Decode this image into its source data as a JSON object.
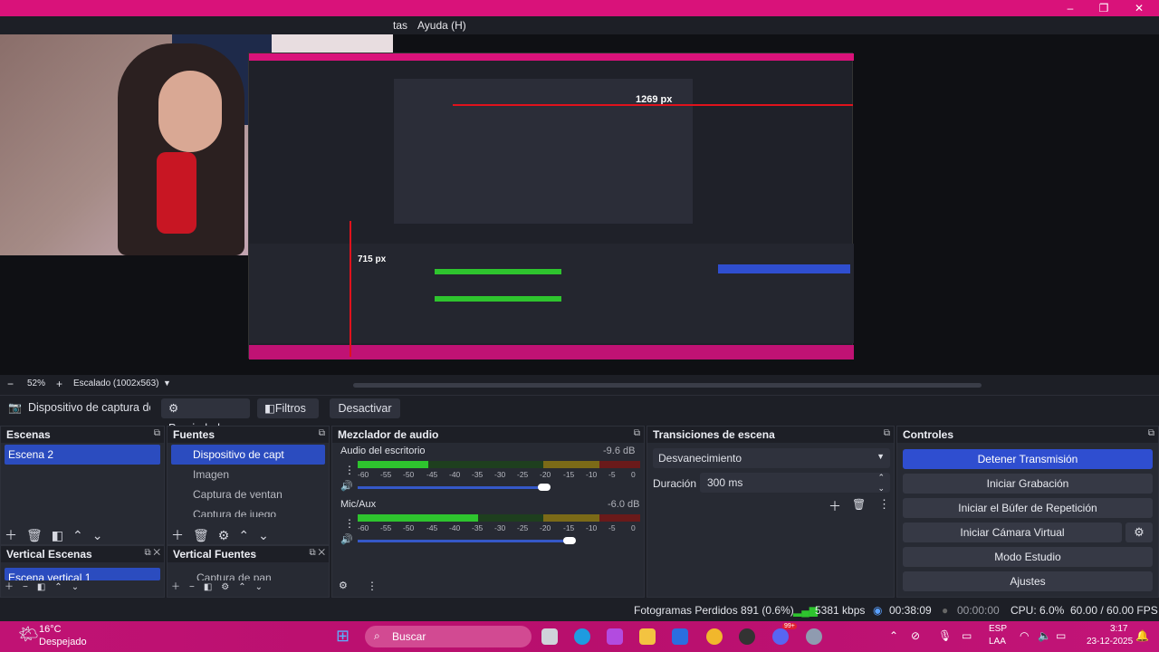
{
  "window": {
    "menu_partial": "tas",
    "menu_help": "Ayuda (H)",
    "minimize": "–",
    "maximize": "❐",
    "close": "✕"
  },
  "nested_preview": {
    "width_label": "1269 px",
    "height_label": "715 px"
  },
  "preview_toolbar": {
    "zoom": "52%",
    "scale_label": "Escalado (1002x563)"
  },
  "source_bar": {
    "source_name": "Dispositivo de captura de v",
    "properties": "Propiedades",
    "filters": "Filtros",
    "deactivate": "Desactivar"
  },
  "scenes": {
    "title": "Escenas",
    "items": [
      "Escena 2"
    ]
  },
  "sources": {
    "title": "Fuentes",
    "items": [
      "Dispositivo de capt",
      "Imagen",
      "Captura de ventan",
      "Captura de juego"
    ]
  },
  "vertical_scenes": {
    "title": "Vertical Escenas",
    "items": [
      "Escena vertical 1"
    ]
  },
  "vertical_sources": {
    "title": "Vertical Fuentes",
    "items": [
      "Captura de pan"
    ]
  },
  "mixer": {
    "title": "Mezclador de audio",
    "channels": [
      {
        "name": "Audio del escritorio",
        "db": "-9.6 dB",
        "level": 0.38,
        "volume": 0.66
      },
      {
        "name": "Mic/Aux",
        "db": "-6.0 dB",
        "level": 0.65,
        "volume": 0.75
      }
    ],
    "scale": [
      "-60",
      "-55",
      "-50",
      "-45",
      "-40",
      "-35",
      "-30",
      "-25",
      "-20",
      "-15",
      "-10",
      "-5",
      "0"
    ]
  },
  "transitions": {
    "title": "Transiciones de escena",
    "selected": "Desvanecimiento",
    "duration_label": "Duración",
    "duration_value": "300 ms"
  },
  "controls": {
    "title": "Controles",
    "buttons": [
      "Detener Transmisión",
      "Iniciar Grabación",
      "Iniciar el Búfer de Repetición",
      "Iniciar Cámara Virtual",
      "Modo Estudio",
      "Ajustes"
    ]
  },
  "status": {
    "frames_dropped": "Fotogramas Perdidos 891 (0.6%)",
    "bitrate": "5381 kbps",
    "stream_time": "00:38:09",
    "record_time": "00:00:00",
    "cpu": "CPU: 6.0%",
    "fps": "60.00 / 60.00 FPS"
  },
  "taskbar": {
    "weather_temp": "16°C",
    "weather_desc": "Despejado",
    "search": "Buscar",
    "lang_top": "ESP",
    "lang_bottom": "LAA",
    "time": "3:17",
    "date": "23-12-2025",
    "notification_badge": "99+"
  }
}
